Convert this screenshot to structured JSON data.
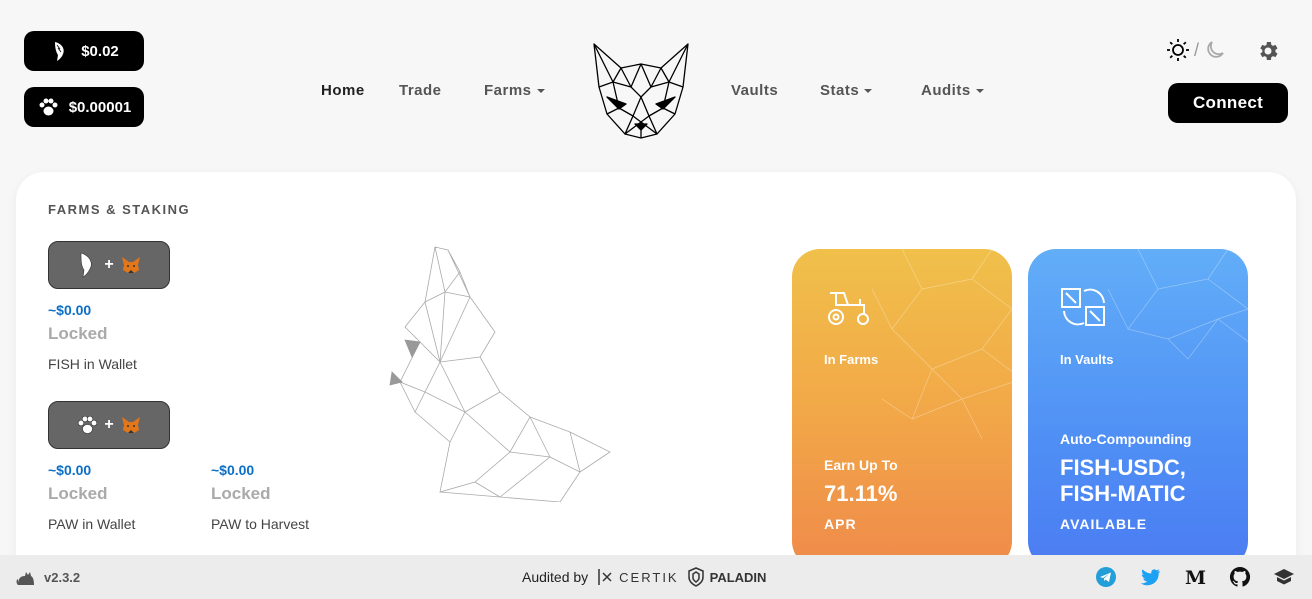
{
  "header": {
    "fish_price": "$0.02",
    "paw_price": "$0.00001",
    "connect_label": "Connect",
    "theme_separator": "/"
  },
  "nav": [
    {
      "label": "Home",
      "dropdown": false,
      "active": true
    },
    {
      "label": "Trade",
      "dropdown": false
    },
    {
      "label": "Farms",
      "dropdown": true
    },
    {
      "label": "Vaults",
      "dropdown": false
    },
    {
      "label": "Stats",
      "dropdown": true
    },
    {
      "label": "Audits",
      "dropdown": true
    }
  ],
  "farms_staking": {
    "title": "FARMS & STAKING",
    "fish_wallet": {
      "usd": "~$0.00",
      "locked": "Locked",
      "label": "FISH in Wallet"
    },
    "paw_wallet": {
      "usd": "~$0.00",
      "locked": "Locked",
      "label": "PAW in Wallet"
    },
    "paw_harvest": {
      "usd": "~$0.00",
      "locked": "Locked",
      "label": "PAW to Harvest"
    },
    "add_symbol": "+"
  },
  "farms_card": {
    "label": "In Farms",
    "earn_label": "Earn Up To",
    "earn_value": "71.11%",
    "earn_unit": "APR",
    "icon": "tractor-icon",
    "color_top": "#f0c04a",
    "color_bottom": "#ef8a4a"
  },
  "vaults_card": {
    "label": "In Vaults",
    "auto_label": "Auto-Compounding",
    "pair_1": "FISH-USDC,",
    "pair_2": "FISH-MATIC",
    "available": "AVAILABLE",
    "icon": "vault-swap-icon",
    "color_top": "#62aef8",
    "color_bottom": "#4b7cf2"
  },
  "footer": {
    "version": "v2.3.2",
    "audited_by": "Audited by",
    "auditor_1": "CERTIK",
    "auditor_2": "PALADIN",
    "social_icons": [
      "telegram-icon",
      "twitter-icon",
      "medium-icon",
      "github-icon",
      "docs-icon"
    ]
  }
}
